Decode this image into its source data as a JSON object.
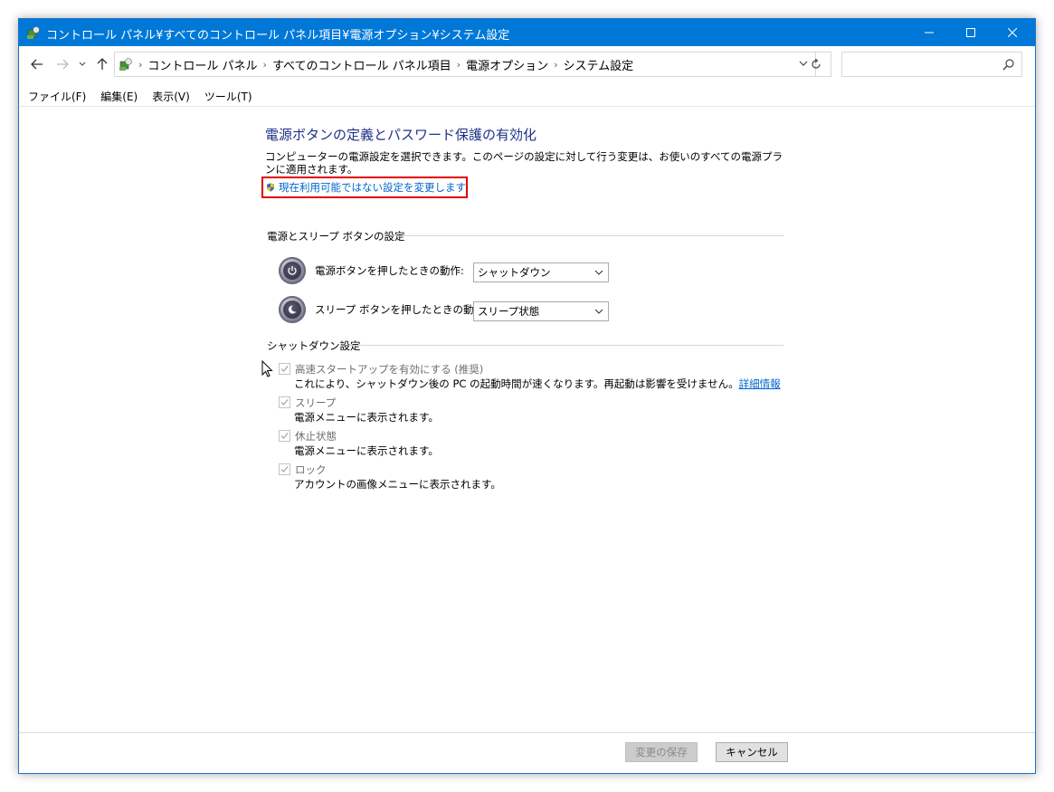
{
  "window": {
    "title": "コントロール パネル¥すべてのコントロール パネル項目¥電源オプション¥システム設定",
    "accent": "#0078d7"
  },
  "address": {
    "crumbs": [
      "コントロール パネル",
      "すべてのコントロール パネル項目",
      "電源オプション",
      "システム設定"
    ],
    "search_placeholder": ""
  },
  "menu": {
    "items": [
      "ファイル(F)",
      "編集(E)",
      "表示(V)",
      "ツール(T)"
    ]
  },
  "main": {
    "heading": "電源ボタンの定義とパスワード保護の有効化",
    "description": "コンピューターの電源設定を選択できます。このページの設定に対して行う変更は、お使いのすべての電源プランに適用されます。",
    "admin_link": "現在利用可能ではない設定を変更します",
    "power_section": {
      "title": "電源とスリープ ボタンの設定",
      "power_button_label": "電源ボタンを押したときの動作:",
      "power_button_value": "シャットダウン",
      "sleep_button_label": "スリープ ボタンを押したときの動作:",
      "sleep_button_value": "スリープ状態"
    },
    "shutdown_section": {
      "title": "シャットダウン設定",
      "options": [
        {
          "label": "高速スタートアップを有効にする (推奨)",
          "desc": "これにより、シャットダウン後の PC の起動時間が速くなります。再起動は影響を受けません。",
          "link": "詳細情報",
          "checked": true
        },
        {
          "label": "スリープ",
          "desc": "電源メニューに表示されます。",
          "checked": true
        },
        {
          "label": "休止状態",
          "desc": "電源メニューに表示されます。",
          "checked": true
        },
        {
          "label": "ロック",
          "desc": "アカウントの画像メニューに表示されます。",
          "checked": true
        }
      ]
    }
  },
  "footer": {
    "save_label": "変更の保存",
    "cancel_label": "キャンセル"
  }
}
